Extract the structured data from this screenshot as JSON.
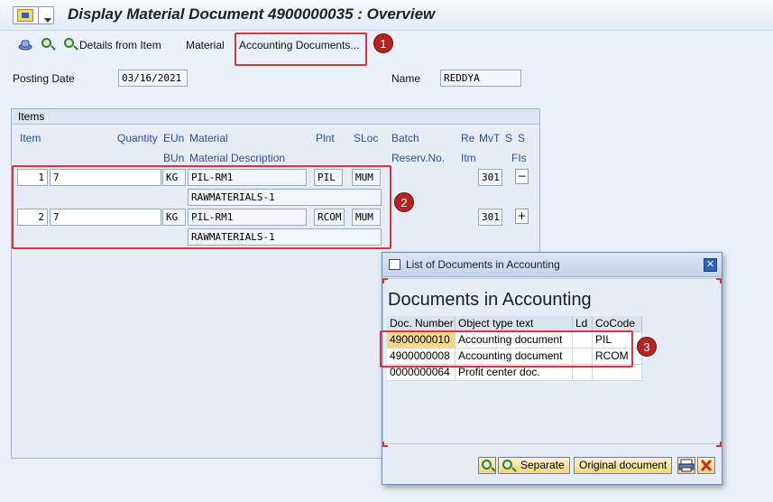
{
  "window": {
    "title": "Display Material Document 4900000035 : Overview"
  },
  "toolbar": {
    "details_label": "Details from Item",
    "material_label": "Material",
    "accounting_docs_label": "Accounting Documents..."
  },
  "header": {
    "posting_date_label": "Posting Date",
    "posting_date": "03/16/2021",
    "name_label": "Name",
    "name_value": "REDDYA"
  },
  "items": {
    "group_title": "Items",
    "columns_row1": {
      "item": "Item",
      "quantity": "Quantity",
      "eun": "EUn",
      "material": "Material",
      "plnt": "Plnt",
      "sloc": "SLoc",
      "batch": "Batch",
      "re": "Re",
      "mvt": "MvT",
      "s1": "S",
      "s2": "S"
    },
    "columns_row2": {
      "bun": "BUn",
      "material_description": "Material Description",
      "reserv_no": "Reserv.No.",
      "itm": "Itm",
      "fis": "FIs"
    },
    "rows": [
      {
        "item": "1",
        "quantity": "7",
        "unit": "KG",
        "material": "PIL-RM1",
        "plant": "PIL",
        "sloc": "MUM",
        "mvt": "301",
        "sign": "−",
        "description": "RAWMATERIALS-1"
      },
      {
        "item": "2",
        "quantity": "7",
        "unit": "KG",
        "material": "PIL-RM1",
        "plant": "RCOM",
        "sloc": "MUM",
        "mvt": "301",
        "sign": "+",
        "description": "RAWMATERIALS-1"
      }
    ]
  },
  "annotations": {
    "badge1": "1",
    "badge2": "2",
    "badge3": "3"
  },
  "dialog": {
    "title": "List of Documents in Accounting",
    "heading": "Documents in Accounting",
    "columns": {
      "doc_number": "Doc. Number",
      "object_type": "Object type text",
      "ld": "Ld",
      "cocode": "CoCode"
    },
    "rows": [
      {
        "doc_number": "4900000010",
        "object_type": "Accounting document",
        "ld": "",
        "cocode": "PIL"
      },
      {
        "doc_number": "4900000008",
        "object_type": "Accounting document",
        "ld": "",
        "cocode": "RCOM"
      },
      {
        "doc_number": "0000000064",
        "object_type": "Profit center doc.",
        "ld": "",
        "cocode": ""
      }
    ],
    "separate_label": "Separate",
    "original_document_label": "Original document",
    "close_glyph": "✕"
  },
  "colors": {
    "accent": "#2b4fb3",
    "highlight": "#e0323a",
    "selected": "#f6d98d"
  }
}
